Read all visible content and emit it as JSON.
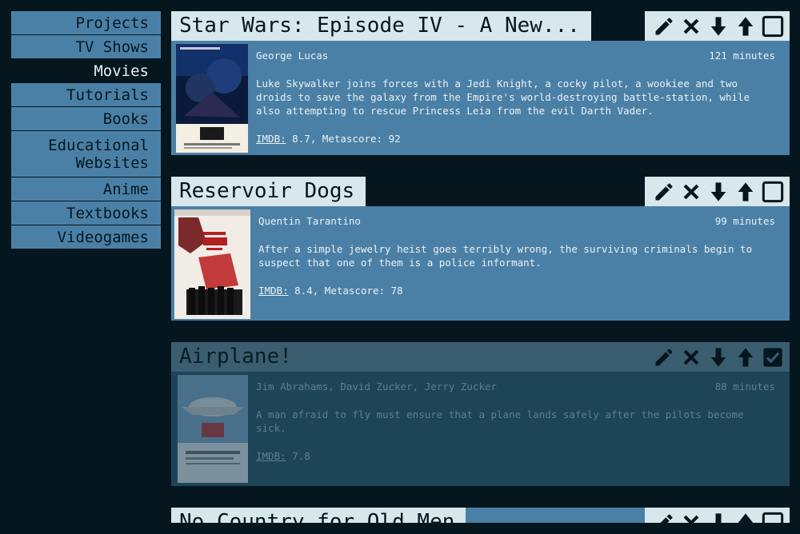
{
  "sidebar": {
    "items": [
      {
        "label": "Projects"
      },
      {
        "label": "TV Shows"
      },
      {
        "label": "Movies"
      },
      {
        "label": "Tutorials"
      },
      {
        "label": "Books"
      },
      {
        "label_line1": "Educational",
        "label_line2": "Websites"
      },
      {
        "label": "Anime"
      },
      {
        "label": "Textbooks"
      },
      {
        "label": "Videogames"
      }
    ],
    "active": "Movies"
  },
  "movies": [
    {
      "title": "Star Wars: Episode IV - A New...",
      "director": "George Lucas",
      "runtime": "121 minutes",
      "description": "Luke Skywalker joins forces with a Jedi Knight, a cocky pilot, a wookiee and two droids to save the galaxy from the Empire's world-destroying battle-station, while also attempting to rescue Princess Leia from the evil Darth Vader.",
      "imdb_label": "IMDB:",
      "ratings": " 8.7, Metascore: 92",
      "completed": false
    },
    {
      "title": "Reservoir Dogs",
      "director": "Quentin Tarantino",
      "runtime": "99 minutes",
      "description": "After a simple jewelry heist goes terribly wrong, the surviving criminals begin to suspect that one of them is a police informant.",
      "imdb_label": "IMDB:",
      "ratings": " 8.4, Metascore: 78",
      "completed": false
    },
    {
      "title": "Airplane!",
      "director": "Jim Abrahams, David Zucker, Jerry Zucker",
      "runtime": "88 minutes",
      "description": "A man afraid to fly must ensure that a plane lands safely after the pilots become sick.",
      "imdb_label": "IMDB:",
      "ratings": " 7.8",
      "completed": true
    },
    {
      "title": "No Country for Old Men",
      "completed": false
    }
  ],
  "icons": {
    "edit": "pencil-icon",
    "delete": "close-icon",
    "move_down": "arrow-down-icon",
    "move_up": "arrow-up-icon",
    "complete": "checkbox-icon"
  },
  "colors": {
    "background": "#06161f",
    "accent": "#4a80a6",
    "title_bg": "#d7e7ec",
    "done_bg": "#1e4458"
  }
}
